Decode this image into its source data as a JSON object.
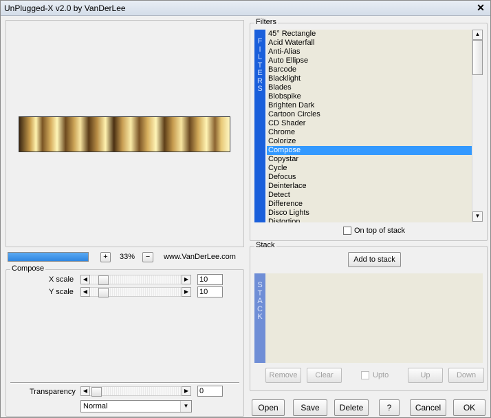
{
  "window": {
    "title": "UnPlugged-X v2.0 by VanDerLee",
    "close_glyph": "✕"
  },
  "preview": {
    "zoom_value": "33%",
    "zoom_plus": "+",
    "zoom_minus": "−",
    "site": "www.VanDerLee.com",
    "progress_fraction": 1.0
  },
  "compose": {
    "group_label": "Compose",
    "xscale": {
      "label": "X scale",
      "value": "10"
    },
    "yscale": {
      "label": "Y scale",
      "value": "10"
    }
  },
  "transparency": {
    "label": "Transparency",
    "value": "0",
    "blend_mode": "Normal"
  },
  "filters": {
    "group_label": "Filters",
    "side_label": [
      "F",
      "I",
      "L",
      "T",
      "E",
      "R",
      "S"
    ],
    "items": [
      "45° Rectangle",
      "Acid Waterfall",
      "Anti-Alias",
      "Auto Ellipse",
      "Barcode",
      "Blacklight",
      "Blades",
      "Blobspike",
      "Brighten Dark",
      "Cartoon Circles",
      "CD Shader",
      "Chrome",
      "Colorize",
      "Compose",
      "Copystar",
      "Cycle",
      "Defocus",
      "Deinterlace",
      "Detect",
      "Difference",
      "Disco Lights",
      "Distortion"
    ],
    "selected": "Compose",
    "on_top_label": "On top of stack"
  },
  "stack": {
    "group_label": "Stack",
    "side_label": [
      "S",
      "T",
      "A",
      "C",
      "K"
    ],
    "add_label": "Add to stack",
    "remove_label": "Remove",
    "clear_label": "Clear",
    "upto_label": "Upto",
    "up_label": "Up",
    "down_label": "Down"
  },
  "footer": {
    "open": "Open",
    "save": "Save",
    "delete": "Delete",
    "help": "?",
    "cancel": "Cancel",
    "ok": "OK"
  },
  "colors": {
    "accent": "#3399ff",
    "sidebar_blue": "#1a5fdb",
    "list_bg": "#ebe9dc",
    "stack_bar": "#6f8ed6"
  },
  "icons": {
    "arrow_left": "◀",
    "arrow_right": "▶",
    "arrow_up": "▲",
    "arrow_down": "▼",
    "dropdown": "▼"
  }
}
